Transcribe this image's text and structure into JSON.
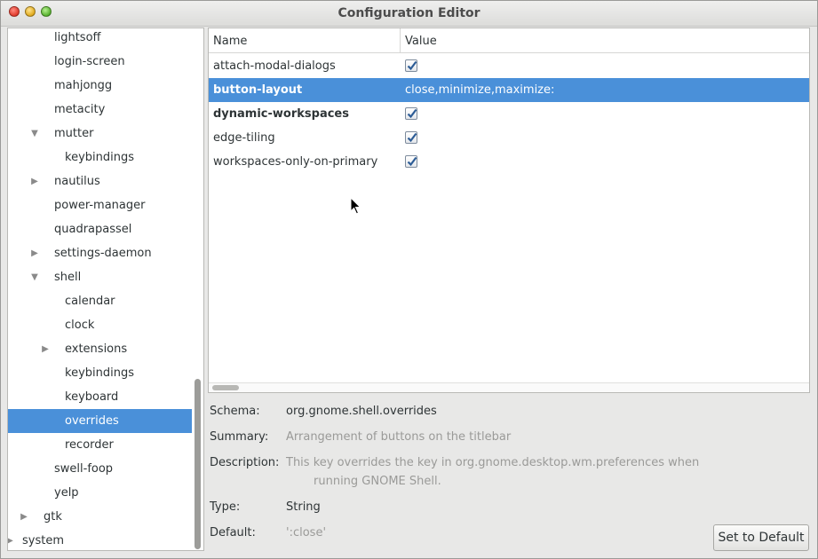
{
  "window": {
    "title": "Configuration Editor"
  },
  "tree": {
    "items": [
      {
        "label": "lightsoff",
        "indent": 1,
        "expander": "none",
        "selected": false
      },
      {
        "label": "login-screen",
        "indent": 1,
        "expander": "none",
        "selected": false
      },
      {
        "label": "mahjongg",
        "indent": 1,
        "expander": "none",
        "selected": false
      },
      {
        "label": "metacity",
        "indent": 1,
        "expander": "none",
        "selected": false
      },
      {
        "label": "mutter",
        "indent": 1,
        "expander": "expanded",
        "selected": false
      },
      {
        "label": "keybindings",
        "indent": 2,
        "expander": "none",
        "selected": false
      },
      {
        "label": "nautilus",
        "indent": 1,
        "expander": "collapsed",
        "selected": false
      },
      {
        "label": "power-manager",
        "indent": 1,
        "expander": "none",
        "selected": false
      },
      {
        "label": "quadrapassel",
        "indent": 1,
        "expander": "none",
        "selected": false
      },
      {
        "label": "settings-daemon",
        "indent": 1,
        "expander": "collapsed",
        "selected": false
      },
      {
        "label": "shell",
        "indent": 1,
        "expander": "expanded",
        "selected": false
      },
      {
        "label": "calendar",
        "indent": 2,
        "expander": "none",
        "selected": false
      },
      {
        "label": "clock",
        "indent": 2,
        "expander": "none",
        "selected": false
      },
      {
        "label": "extensions",
        "indent": 2,
        "expander": "collapsed",
        "selected": false
      },
      {
        "label": "keybindings",
        "indent": 2,
        "expander": "none",
        "selected": false
      },
      {
        "label": "keyboard",
        "indent": 2,
        "expander": "none",
        "selected": false
      },
      {
        "label": "overrides",
        "indent": 2,
        "expander": "none",
        "selected": true
      },
      {
        "label": "recorder",
        "indent": 2,
        "expander": "none",
        "selected": false
      },
      {
        "label": "swell-foop",
        "indent": 1,
        "expander": "none",
        "selected": false
      },
      {
        "label": "yelp",
        "indent": 1,
        "expander": "none",
        "selected": false
      },
      {
        "label": "gtk",
        "indent": 0,
        "expander": "collapsed",
        "selected": false
      },
      {
        "label": "system",
        "indent": -1,
        "expander": "collapsed",
        "selected": false
      }
    ]
  },
  "table": {
    "col_name": "Name",
    "col_value": "Value",
    "rows": [
      {
        "name": "attach-modal-dialogs",
        "type": "bool",
        "value": "",
        "checked": true,
        "bold": false,
        "selected": false
      },
      {
        "name": "button-layout",
        "type": "string",
        "value": "close,minimize,maximize:",
        "checked": false,
        "bold": true,
        "selected": true
      },
      {
        "name": "dynamic-workspaces",
        "type": "bool",
        "value": "",
        "checked": true,
        "bold": true,
        "selected": false
      },
      {
        "name": "edge-tiling",
        "type": "bool",
        "value": "",
        "checked": true,
        "bold": false,
        "selected": false
      },
      {
        "name": "workspaces-only-on-primary",
        "type": "bool",
        "value": "",
        "checked": true,
        "bold": false,
        "selected": false
      }
    ]
  },
  "details": {
    "schema_label": "Schema:",
    "schema_value": "org.gnome.shell.overrides",
    "summary_label": "Summary:",
    "summary_value": "Arrangement of buttons on the titlebar",
    "description_label": "Description:",
    "description_line1": "This key overrides the key in org.gnome.desktop.wm.preferences when",
    "description_line2": "running GNOME Shell.",
    "type_label": "Type:",
    "type_value": "String",
    "default_label": "Default:",
    "default_value": "':close'",
    "set_default_button": "Set to Default"
  },
  "colors": {
    "selection": "#4a90d9",
    "checkbox_check": "#2c5c96"
  }
}
